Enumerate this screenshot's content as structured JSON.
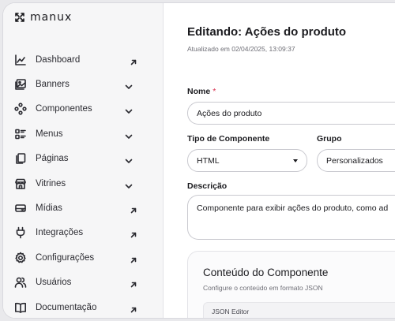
{
  "app": {
    "logo_text": "manux"
  },
  "sidebar": {
    "items": [
      {
        "label": "Dashboard",
        "icon": "chart-line-icon",
        "trail": "external-arrow"
      },
      {
        "label": "Banners",
        "icon": "image-icon",
        "trail": "chevron-down"
      },
      {
        "label": "Componentes",
        "icon": "components-icon",
        "trail": "chevron-down"
      },
      {
        "label": "Menus",
        "icon": "menu-list-icon",
        "trail": "chevron-down"
      },
      {
        "label": "Páginas",
        "icon": "pages-icon",
        "trail": "chevron-down"
      },
      {
        "label": "Vitrines",
        "icon": "storefront-icon",
        "trail": "chevron-down"
      },
      {
        "label": "Mídias",
        "icon": "media-drive-icon",
        "trail": "external-arrow"
      },
      {
        "label": "Integrações",
        "icon": "plug-icon",
        "trail": "external-arrow"
      },
      {
        "label": "Configurações",
        "icon": "gear-icon",
        "trail": "external-arrow"
      },
      {
        "label": "Usuários",
        "icon": "users-icon",
        "trail": "external-arrow"
      },
      {
        "label": "Documentação",
        "icon": "book-icon",
        "trail": "external-arrow"
      }
    ]
  },
  "main": {
    "title": "Editando: Ações do produto",
    "updated": "Atualizado em 02/04/2025, 13:09:37",
    "fields": {
      "nome_label": "Nome",
      "nome_required": "*",
      "nome_value": "Ações do produto",
      "tipo_label": "Tipo de Componente",
      "tipo_value": "HTML",
      "grupo_label": "Grupo",
      "grupo_value": "Personalizados",
      "descricao_label": "Descrição",
      "descricao_value": "Componente para exibir ações do produto, como ad"
    },
    "card": {
      "title": "Conteúdo do Componente",
      "subtitle": "Configure o conteúdo em formato JSON",
      "editor_label": "JSON Editor"
    }
  },
  "colors": {
    "required": "#d9304f",
    "sidebar_bg": "#f6f6f7",
    "border": "#c9c9cf"
  }
}
